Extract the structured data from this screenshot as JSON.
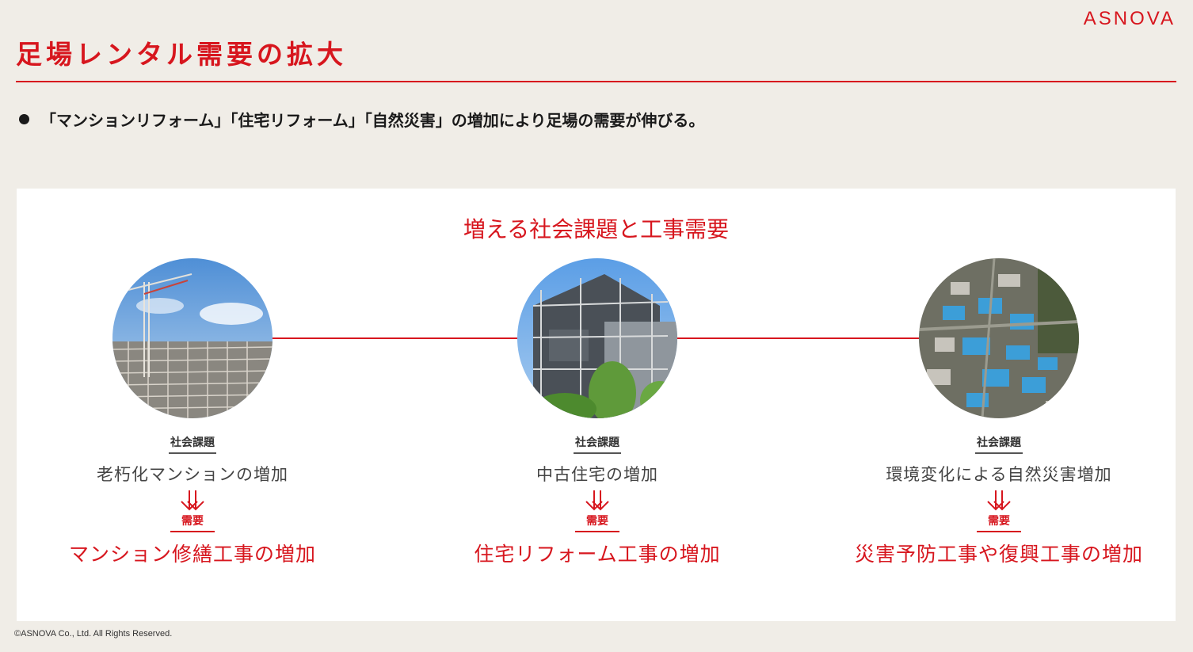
{
  "brand": {
    "logo_text": "ASNOVA",
    "accent": "#d7161e"
  },
  "header": {
    "title": "足場レンタル需要の拡大"
  },
  "bullet": "「マンションリフォーム」「住宅リフォーム」「自然災害」の増加により足場の需要が伸びる。",
  "panel": {
    "title": "増える社会課題と工事需要",
    "columns": [
      {
        "image": "crane-construction-photo",
        "issue_label": "社会課題",
        "issue": "老朽化マンションの増加",
        "demand_label": "需要",
        "demand": "マンション修繕工事の増加"
      },
      {
        "image": "house-scaffolding-photo",
        "issue_label": "社会課題",
        "issue": "中古住宅の増加",
        "demand_label": "需要",
        "demand": "住宅リフォーム工事の増加"
      },
      {
        "image": "disaster-aerial-photo",
        "issue_label": "社会課題",
        "issue": "環境変化による自然災害増加",
        "demand_label": "需要",
        "demand": "災害予防工事や復興工事の増加"
      }
    ]
  },
  "footer": {
    "copyright": "©ASNOVA Co., Ltd. All Rights Reserved."
  }
}
